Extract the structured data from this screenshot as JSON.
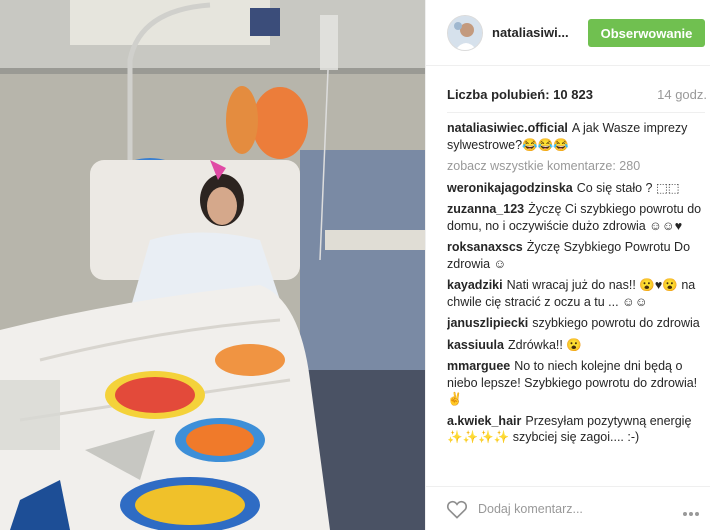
{
  "post": {
    "username": "nataliasiwi...",
    "follow_label": "Obserwowanie",
    "likes_text": "Liczba polubień: 10 823",
    "time_text": "14 godz.",
    "view_all_text": "zobacz wszystkie komentarze: 280",
    "add_comment_placeholder": "Dodaj komentarz...",
    "accent_color": "#70c050"
  },
  "caption": {
    "user": "nataliasiwiec.official",
    "text": "A jak Wasze imprezy sylwestrowe?😂😂😂"
  },
  "comments": [
    {
      "user": "weronikajagodzinska",
      "text": "Co się stało ? ⬚⬚"
    },
    {
      "user": "zuzanna_123",
      "text": "Życzę Ci szybkiego powrotu do domu, no i oczywiście dużo zdrowia ☺☺♥"
    },
    {
      "user": "roksanaxscs",
      "text": "Życzę Szybkiego Powrotu Do zdrowia ☺"
    },
    {
      "user": "kayadziki",
      "text": "Nati wracaj już do nas!! 😮♥😮 na chwile cię stracić z oczu a tu ... ☺☺"
    },
    {
      "user": "januszlipiecki",
      "text": "szybkiego powrotu do zdrowia"
    },
    {
      "user": "kassiuula",
      "text": "Zdrówka!! 😮"
    },
    {
      "user": "mmarguee",
      "text": "No to niech kolejne dni będą o niebo lepsze! Szybkiego powrotu do zdrowia! ✌"
    },
    {
      "user": "a.kwiek_hair",
      "text": "Przesyłam pozytywną energię ✨✨✨✨ szybciej się zagoi.... :-)"
    }
  ],
  "icons": {
    "heart": "heart-icon",
    "more": "more-options-icon",
    "avatar": "avatar"
  }
}
